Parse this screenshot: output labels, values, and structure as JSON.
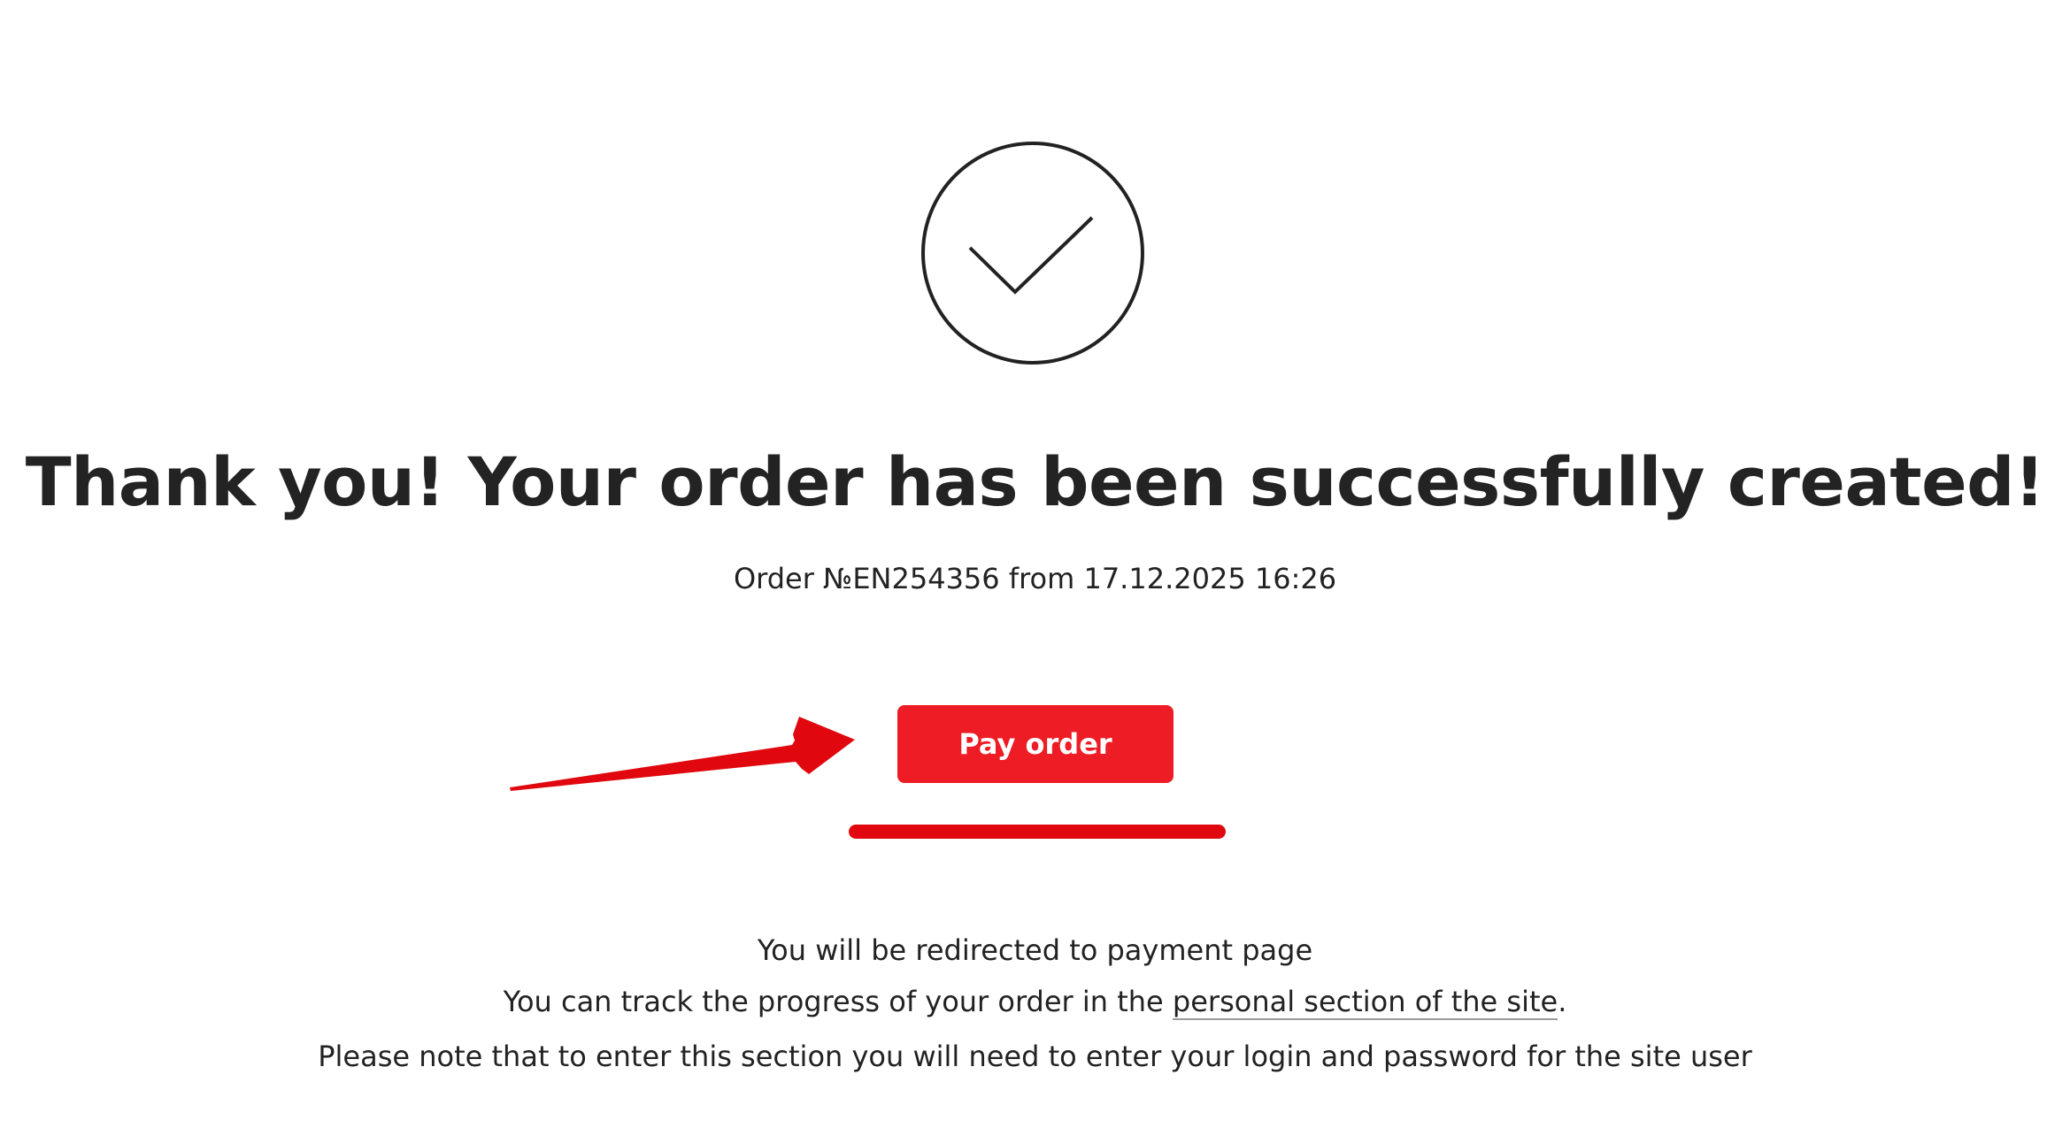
{
  "success_icon": "checkmark-circle-icon",
  "title": "Thank you! Your order has been successfully created!",
  "order": {
    "line": "Order №EN254356 from 17.12.2025 16:26"
  },
  "pay_button": {
    "label": "Pay order"
  },
  "info": {
    "redirect": "You will be redirected to payment page",
    "track_prefix": "You can track the progress of your order in the ",
    "track_link": "personal section of the site",
    "track_suffix": ".",
    "login_note": "Please note that to enter this section you will need to enter your login and password for the site user"
  },
  "colors": {
    "accent": "#ee1c25",
    "annotation": "#e0080e",
    "text": "#222222"
  }
}
